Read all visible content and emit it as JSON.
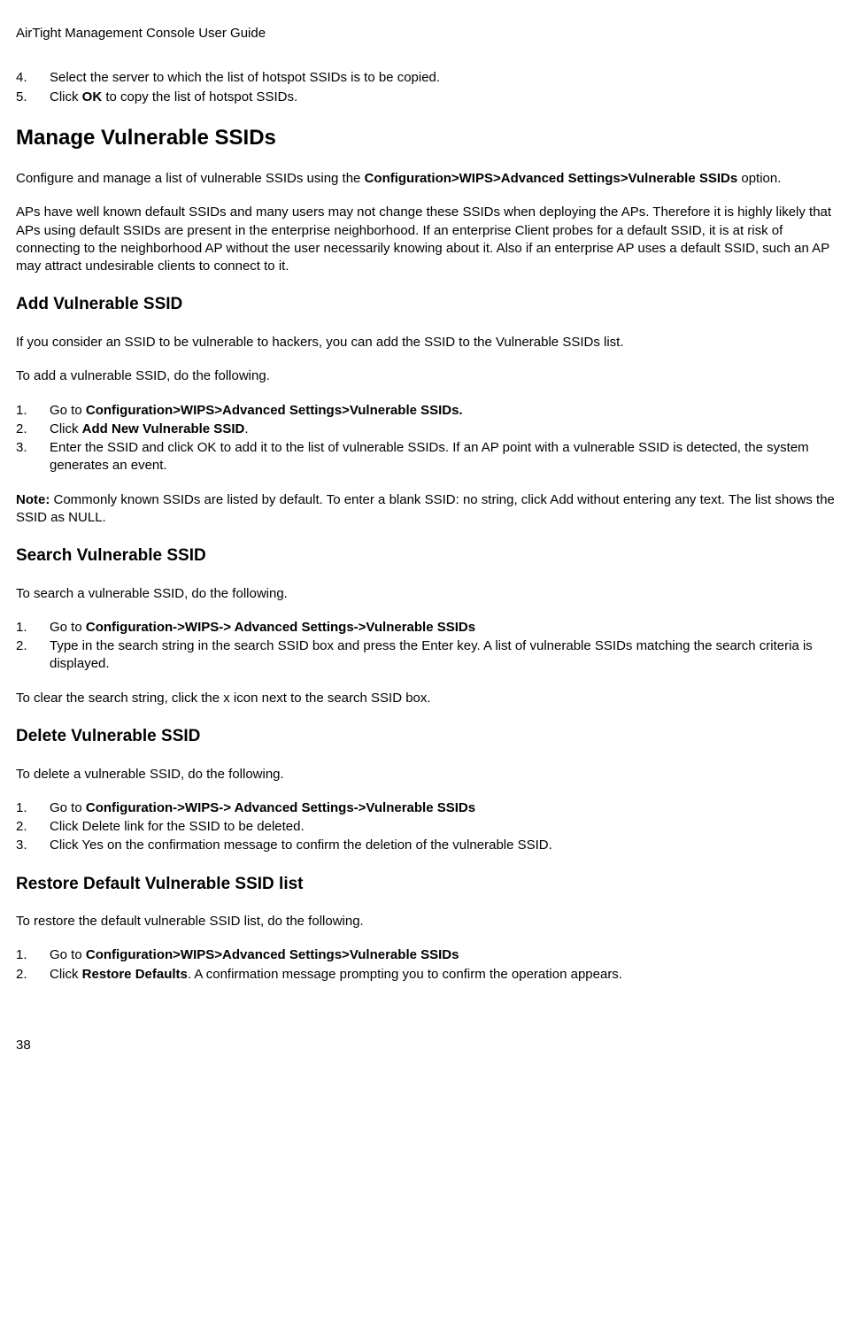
{
  "header": "AirTight Management Console User Guide",
  "list1": {
    "items": [
      {
        "num": "4.",
        "text": "Select the server to which the list of hotspot SSIDs is to be copied."
      },
      {
        "num": "5.",
        "prefix": "Click ",
        "bold": "OK",
        "suffix": " to copy the list of hotspot SSIDs."
      }
    ]
  },
  "h1_manage": "Manage Vulnerable SSIDs",
  "para1": {
    "prefix": "Configure and manage a list of vulnerable SSIDs using the ",
    "bold": "Configuration>WIPS>Advanced Settings>Vulnerable SSIDs",
    "suffix": " option."
  },
  "para2": "APs have well known default SSIDs and many users may not change these SSIDs when deploying the APs. Therefore it is highly likely that APs using default SSIDs are present in the enterprise neighborhood. If an enterprise Client probes for a default SSID, it is at risk of connecting to the neighborhood AP without the user necessarily knowing about it. Also if an enterprise AP uses a default SSID, such an AP may attract undesirable clients to connect to it.",
  "h2_add": "Add Vulnerable SSID",
  "para3": "If you consider an SSID to be vulnerable to hackers, you can add the SSID to the Vulnerable SSIDs list.",
  "para4": "To add a vulnerable SSID, do the following.",
  "list2": {
    "items": [
      {
        "num": "1.",
        "prefix": "Go to ",
        "bold": "Configuration>WIPS>Advanced Settings>Vulnerable SSIDs.",
        "suffix": ""
      },
      {
        "num": "2.",
        "prefix": "Click ",
        "bold": "Add New Vulnerable SSID",
        "suffix": "."
      },
      {
        "num": "3.",
        "text": "Enter the SSID and click OK to add it to the list of vulnerable SSIDs. If an AP point with a vulnerable SSID is detected, the system generates an event."
      }
    ]
  },
  "note": {
    "bold": "Note:",
    "text": " Commonly known SSIDs are listed by default. To enter a blank SSID: no string, click Add without entering any text. The list shows the SSID as NULL."
  },
  "h2_search": "Search Vulnerable SSID",
  "para5": "To search a vulnerable SSID, do the following.",
  "list3": {
    "items": [
      {
        "num": "1.",
        "prefix": "Go to ",
        "bold": "Configuration->WIPS-> Advanced Settings->Vulnerable SSIDs",
        "suffix": ""
      },
      {
        "num": "2.",
        "text": "Type in the search string in the search SSID box and press the Enter key. A list of vulnerable SSIDs matching the search criteria is displayed."
      }
    ]
  },
  "para6": "To clear the search string, click the x icon next to the search SSID box.",
  "h2_delete": "Delete Vulnerable SSID",
  "para7": "To delete a vulnerable SSID, do the following.",
  "list4": {
    "items": [
      {
        "num": "1.",
        "prefix": "Go to ",
        "bold": "Configuration->WIPS-> Advanced Settings->Vulnerable SSIDs",
        "suffix": ""
      },
      {
        "num": "2.",
        "text": "Click Delete link for the SSID to be deleted."
      },
      {
        "num": "3.",
        "text": "Click Yes on the confirmation message to confirm the deletion of the vulnerable SSID."
      }
    ]
  },
  "h2_restore": "Restore Default Vulnerable SSID list",
  "para8": "To restore the default vulnerable SSID list, do the following.",
  "list5": {
    "items": [
      {
        "num": "1.",
        "prefix": "Go to ",
        "bold": "Configuration>WIPS>Advanced Settings>Vulnerable SSIDs",
        "suffix": ""
      },
      {
        "num": "2.",
        "prefix": "Click ",
        "bold": "Restore Defaults",
        "suffix": ". A confirmation message prompting you to confirm the operation appears."
      }
    ]
  },
  "pageNum": "38"
}
